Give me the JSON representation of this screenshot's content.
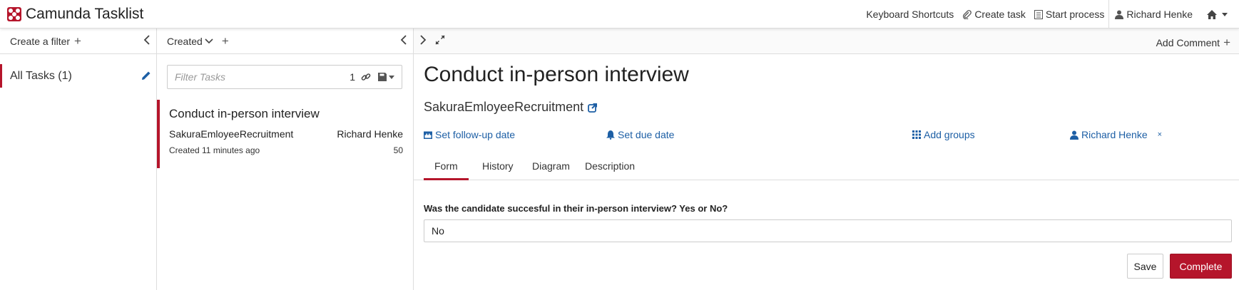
{
  "app": {
    "title": "Camunda Tasklist",
    "accent_color": "#b5152b",
    "link_color": "#1d5fa5"
  },
  "header": {
    "keyboard_shortcuts": "Keyboard Shortcuts",
    "create_task": "Create task",
    "start_process": "Start process",
    "user": "Richard Henke",
    "home_icon": "home-icon"
  },
  "filters": {
    "create_label": "Create a filter",
    "items": [
      {
        "label": "All Tasks (1)"
      }
    ]
  },
  "task_list": {
    "sort_label": "Created",
    "filter_placeholder": "Filter Tasks",
    "filter_count": "1",
    "tasks": [
      {
        "name": "Conduct in-person interview",
        "process": "SakuraEmloyeeRecruitment",
        "assignee": "Richard Henke",
        "created": "Created 11 minutes ago",
        "priority": "50"
      }
    ]
  },
  "task": {
    "add_comment": "Add Comment",
    "title": "Conduct in-person interview",
    "process_name": "SakuraEmloyeeRecruitment",
    "follow_up": "Set follow-up date",
    "due_date": "Set due date",
    "add_groups": "Add groups",
    "assignee": "Richard Henke",
    "remove_assignee": "×",
    "tabs": [
      "Form",
      "History",
      "Diagram",
      "Description"
    ],
    "active_tab": "Form",
    "form": {
      "question": "Was the candidate succesful in their in-person interview? Yes or No?",
      "answer": "No",
      "save_label": "Save",
      "complete_label": "Complete"
    }
  }
}
